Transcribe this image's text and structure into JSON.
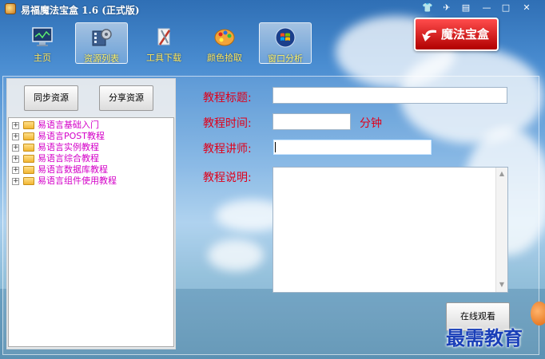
{
  "window": {
    "title": "易福魔法宝盒 1.6 (正式版)",
    "controls": [
      "shirt-icon",
      "chat-icon",
      "menu-icon",
      "minimize-icon",
      "maximize-icon",
      "close-icon"
    ]
  },
  "toolbar": {
    "items": [
      {
        "label": "主页",
        "icon": "monitor-icon"
      },
      {
        "label": "资源列表",
        "icon": "film-gear-icon",
        "active": true
      },
      {
        "label": "工具下载",
        "icon": "tools-icon"
      },
      {
        "label": "颜色拾取",
        "icon": "palette-icon"
      },
      {
        "label": "窗口分析",
        "icon": "windows-logo-icon"
      }
    ]
  },
  "logo": {
    "text": "魔法宝盒",
    "icon": "arrow-icon"
  },
  "left_panel": {
    "sync_button": "同步资源",
    "share_button": "分享资源",
    "tree": [
      {
        "label": "易语言基础入门"
      },
      {
        "label": "易语言POST教程"
      },
      {
        "label": "易语言实例教程"
      },
      {
        "label": "易语言综合教程"
      },
      {
        "label": "易语言数据库教程"
      },
      {
        "label": "易语言组件使用教程"
      }
    ]
  },
  "form": {
    "title_label": "教程标题:",
    "title_value": "",
    "time_label": "教程时间:",
    "time_value": "",
    "time_unit": "分钟",
    "teacher_label": "教程讲师:",
    "teacher_value": "",
    "desc_label": "教程说明:",
    "desc_value": ""
  },
  "actions": {
    "watch_button": "在线观看"
  },
  "watermark": "最需教育",
  "colors": {
    "label_red": "#e0001a",
    "tree_magenta": "#d400c8",
    "toolbar_yellow": "#ffe85c",
    "logo_red": "#d40000"
  }
}
